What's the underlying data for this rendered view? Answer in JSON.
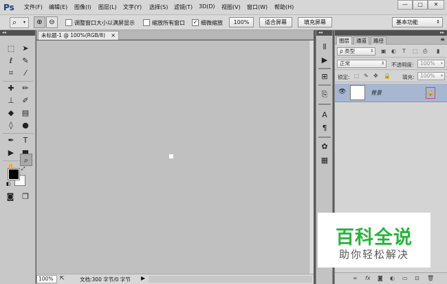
{
  "app": {
    "logo": "Ps",
    "menu": [
      "文件(F)",
      "编辑(E)",
      "图像(I)",
      "图层(L)",
      "文字(Y)",
      "选择(S)",
      "滤镜(T)",
      "3D(D)",
      "视图(V)",
      "窗口(W)",
      "帮助(H)"
    ],
    "window_buttons": [
      "—",
      "□",
      "✕"
    ]
  },
  "options": {
    "resize_windows": "调整窗口大小以满屏显示",
    "zoom_all_windows": "缩放所有窗口",
    "scrubby_zoom": "细微缩放",
    "zoom_100": "100%",
    "fit_screen": "适合屏幕",
    "fill_screen": "填充屏幕",
    "workspace": "基本功能"
  },
  "document": {
    "tab_title": "未标题-1 @ 100%(RGB/8)",
    "tab_close": "×"
  },
  "status": {
    "zoom": "100%",
    "doc_info": "文档:300 字节/0 字节"
  },
  "layers_panel": {
    "tabs": [
      "图层",
      "通道",
      "路径"
    ],
    "filter_kind": "ρ 类型",
    "blend_mode": "正常",
    "opacity_label": "不透明度:",
    "opacity_value": "100%",
    "lock_label": "锁定:",
    "fill_label": "填充:",
    "fill_value": "100%",
    "layer_name": "背景"
  },
  "watermark": {
    "title": "百科全说",
    "subtitle": "助你轻松解决"
  },
  "colors": {
    "foreground": "#000000",
    "background": "#ffffff",
    "watermark_green": "#27b53d",
    "selected_layer": "#a7b6d1"
  }
}
